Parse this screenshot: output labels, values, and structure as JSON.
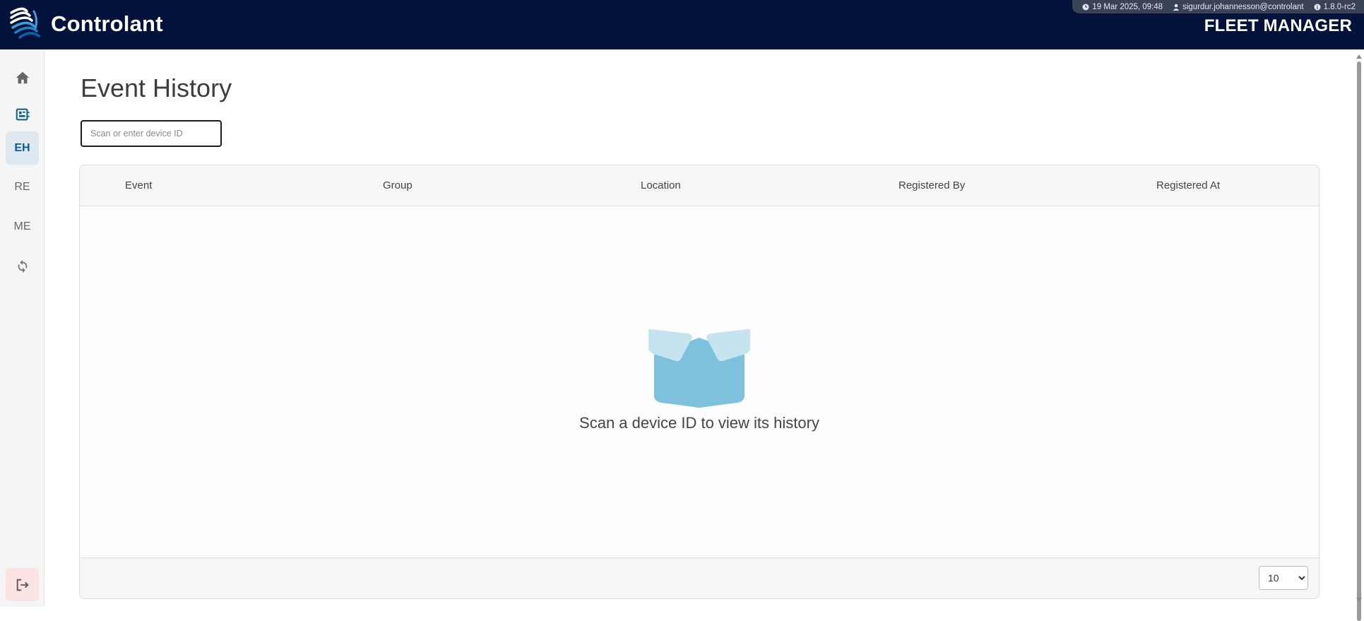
{
  "header": {
    "brand": "Controlant",
    "app_title": "FLEET MANAGER",
    "meta": {
      "datetime": "19 Mar 2025, 09:48",
      "user": "sigurdur.johannesson@controlant",
      "version": "1.8.0-rc2"
    }
  },
  "sidebar": {
    "items": [
      {
        "name": "home",
        "icon": "home-icon",
        "label": ""
      },
      {
        "name": "device-board",
        "icon": "board-icon",
        "label": ""
      },
      {
        "name": "event-history",
        "icon": "",
        "label": "EH",
        "active": true
      },
      {
        "name": "re",
        "icon": "",
        "label": "RE"
      },
      {
        "name": "me",
        "icon": "",
        "label": "ME"
      },
      {
        "name": "sync",
        "icon": "sync-icon",
        "label": ""
      }
    ],
    "logout_icon": "logout-icon"
  },
  "main": {
    "title": "Event History",
    "search": {
      "placeholder": "Scan or enter device ID",
      "value": ""
    },
    "table": {
      "columns": [
        "Event",
        "Group",
        "Location",
        "Registered By",
        "Registered At"
      ],
      "rows": [],
      "empty_message": "Scan a device ID to view its history",
      "page_size": "10",
      "page_size_options": [
        "10"
      ]
    }
  },
  "colors": {
    "header_bg": "#02123a",
    "accent_blue": "#0d5c97",
    "active_nav_bg": "#dde8f1",
    "logout_bg": "#fbe3e3",
    "box_light": "#c6e3f0",
    "box_dark": "#7ec1dd"
  }
}
